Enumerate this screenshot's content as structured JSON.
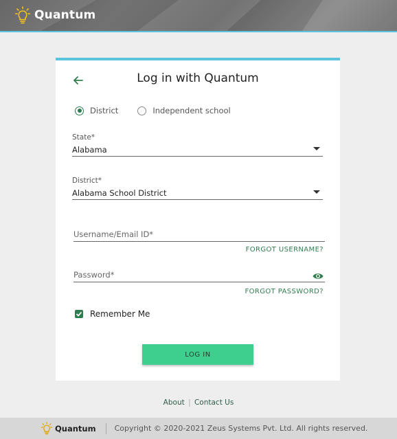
{
  "header": {
    "brand": "Quantum"
  },
  "card": {
    "title": "Log in with Quantum",
    "radios": [
      {
        "label": "District",
        "selected": true
      },
      {
        "label": "Independent school",
        "selected": false
      }
    ],
    "state": {
      "label": "State*",
      "value": "Alabama"
    },
    "district": {
      "label": "District*",
      "value": "Alabama School District"
    },
    "username": {
      "placeholder": "Username/Email ID*"
    },
    "forgot_username": "FORGOT USERNAME?",
    "password": {
      "placeholder": "Password*"
    },
    "forgot_password": "FORGOT PASSWORD?",
    "remember": {
      "label": "Remember Me",
      "checked": true
    },
    "login_button": "LOG IN"
  },
  "footer": {
    "about": "About",
    "separator": "|",
    "contact": "Contact Us",
    "brand": "Quantum",
    "copyright": "Copyright © 2020-2021 Zeus Systems Pvt. Ltd. All rights reserved."
  },
  "colors": {
    "accent_top": "#5bc3dc",
    "primary_green": "#2e7d4f",
    "button_green": "#3ecf8e",
    "bulb_yellow": "#f5c518"
  },
  "icons": [
    "lightbulb-icon",
    "arrow-left-icon",
    "eye-icon",
    "check-icon",
    "chevron-down-icon"
  ]
}
